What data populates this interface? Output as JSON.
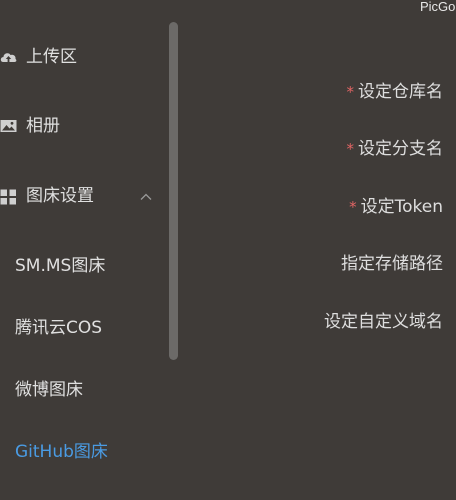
{
  "app": {
    "title": "PicGo"
  },
  "sidebar": {
    "items": [
      {
        "label": "上传区",
        "icon": "cloud-upload-icon"
      },
      {
        "label": "相册",
        "icon": "image-icon"
      },
      {
        "label": "图床设置",
        "icon": "grid-icon",
        "expanded": true
      }
    ],
    "sub_items": [
      {
        "label": "SM.MS图床"
      },
      {
        "label": "腾讯云COS"
      },
      {
        "label": "微博图床"
      },
      {
        "label": "GitHub图床",
        "active": true
      }
    ]
  },
  "form": {
    "required_mark": "*",
    "fields": [
      {
        "label": "设定仓库名",
        "required": true
      },
      {
        "label": "设定分支名",
        "required": true
      },
      {
        "label": "设定Token",
        "required": true
      },
      {
        "label": "指定存储路径",
        "required": false
      },
      {
        "label": "设定自定义域名",
        "required": false
      }
    ]
  },
  "colors": {
    "background": "#3f3b38",
    "text": "#dcdcdc",
    "active": "#4a9be3",
    "required": "#e26565",
    "scrollbar": "#6c6a68"
  }
}
